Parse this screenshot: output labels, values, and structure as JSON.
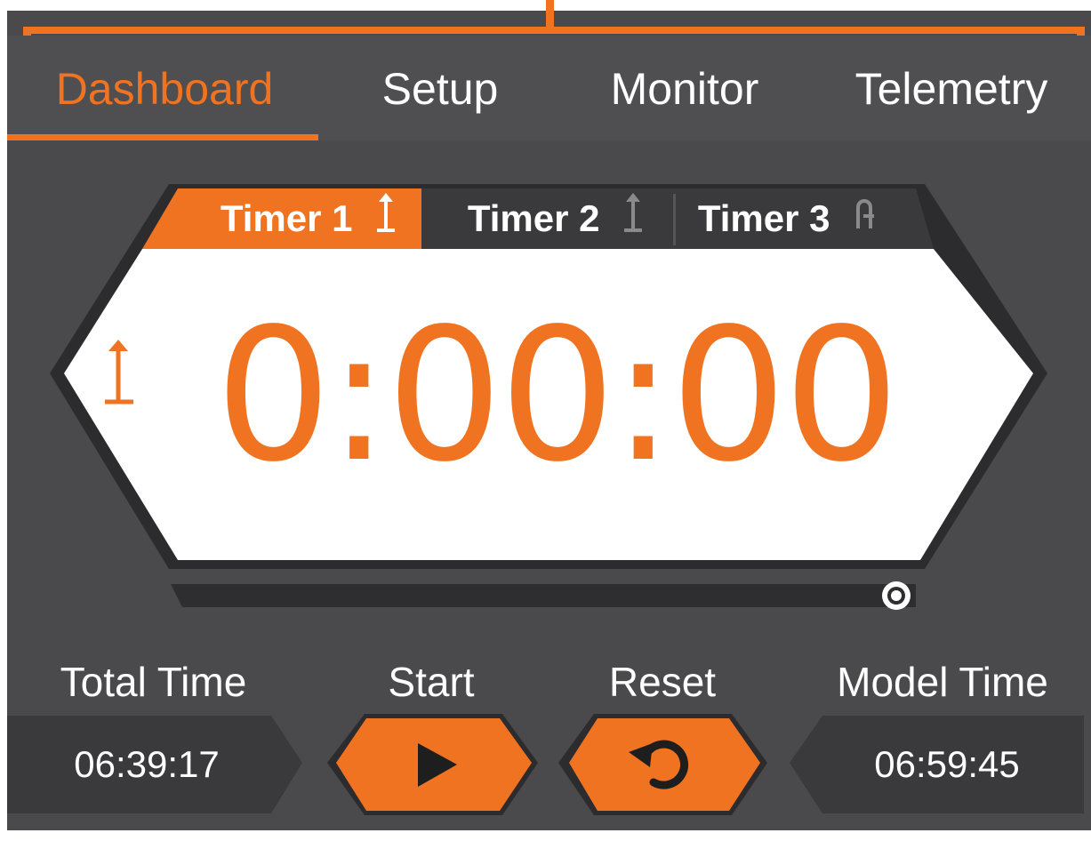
{
  "nav": {
    "tabs": [
      {
        "label": "Dashboard",
        "active": true
      },
      {
        "label": "Setup",
        "active": false
      },
      {
        "label": "Monitor",
        "active": false
      },
      {
        "label": "Telemetry",
        "active": false
      }
    ]
  },
  "timers": {
    "tabs": [
      {
        "label": "Timer 1",
        "icon": "count-up-icon",
        "active": true
      },
      {
        "label": "Timer 2",
        "icon": "count-up-icon",
        "active": false
      },
      {
        "label": "Timer 3",
        "icon": "hold-icon",
        "active": false
      }
    ],
    "display": "0:00:00",
    "mode_icon": "count-up-icon",
    "progress": 1.0
  },
  "controls": {
    "total_time_label": "Total Time",
    "total_time_value": "06:39:17",
    "start_label": "Start",
    "start_icon": "play-icon",
    "reset_label": "Reset",
    "reset_icon": "reset-icon",
    "model_time_label": "Model Time",
    "model_time_value": "06:59:45"
  },
  "colors": {
    "accent": "#f07322",
    "background": "#4a4a4c",
    "tab_dark": "#3a3a3c",
    "display_bg": "#ffffff"
  }
}
